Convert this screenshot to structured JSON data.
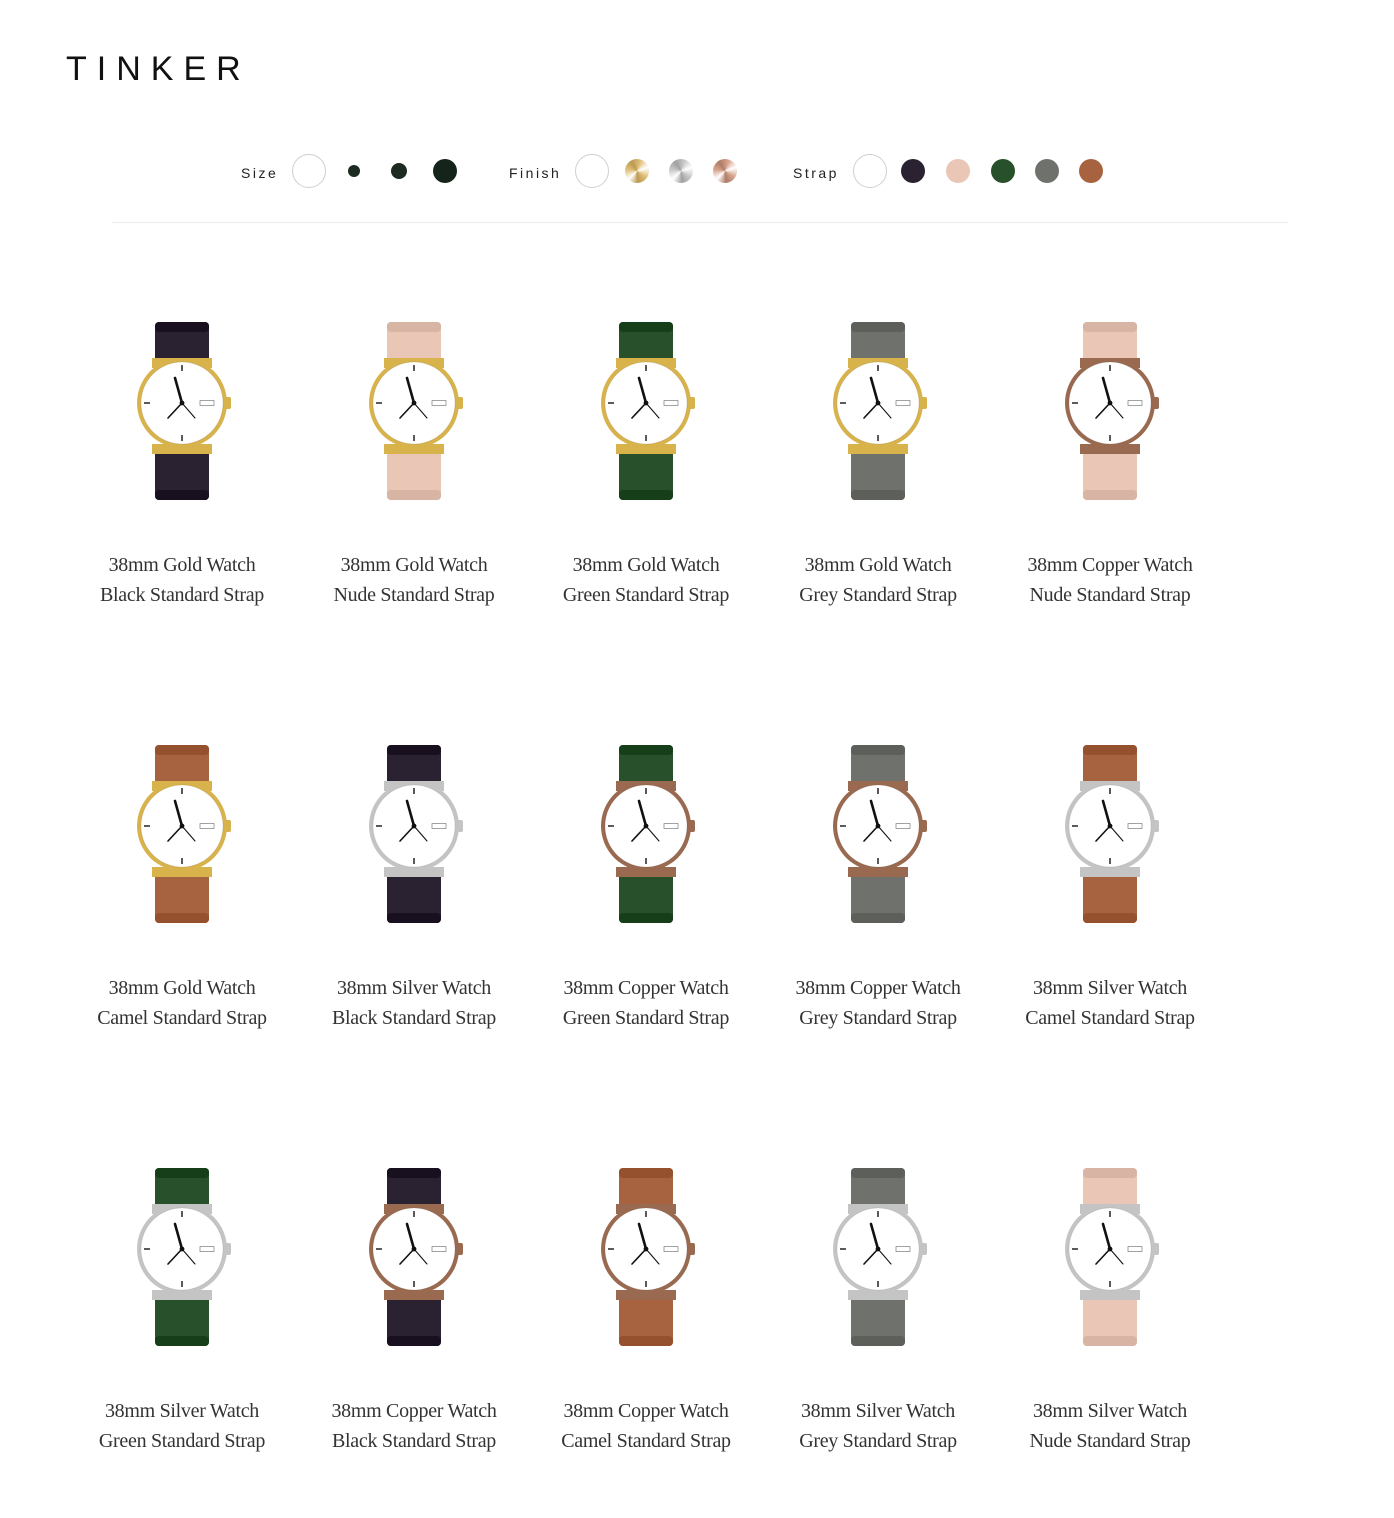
{
  "brand": {
    "logo_text": "TINKER"
  },
  "filters": {
    "size": {
      "label": "Size",
      "options": [
        {
          "name": "all",
          "color": "#ffffff"
        },
        {
          "name": "small",
          "color": "#1c2a20"
        },
        {
          "name": "medium",
          "color": "#1c2a20"
        },
        {
          "name": "large",
          "color": "#14241a"
        }
      ]
    },
    "finish": {
      "label": "Finish",
      "options": [
        {
          "name": "all",
          "color": "#ffffff"
        },
        {
          "name": "gold",
          "color": "#e2c17a"
        },
        {
          "name": "silver",
          "color": "#c9c9c9"
        },
        {
          "name": "copper",
          "color": "#d7a58f"
        }
      ]
    },
    "strap": {
      "label": "Strap",
      "options": [
        {
          "name": "all",
          "color": "#ffffff"
        },
        {
          "name": "black",
          "color": "#2a2230"
        },
        {
          "name": "nude",
          "color": "#e9c6b6"
        },
        {
          "name": "green",
          "color": "#28502a"
        },
        {
          "name": "grey",
          "color": "#6e716c"
        },
        {
          "name": "camel",
          "color": "#a7623f"
        }
      ]
    }
  },
  "products": [
    {
      "line1": "38mm Gold Watch",
      "line2": "Black Standard Strap",
      "finish": "gold",
      "strap": "black"
    },
    {
      "line1": "38mm Gold Watch",
      "line2": "Nude Standard Strap",
      "finish": "gold",
      "strap": "nude"
    },
    {
      "line1": "38mm Gold Watch",
      "line2": "Green Standard Strap",
      "finish": "gold",
      "strap": "green"
    },
    {
      "line1": "38mm Gold Watch",
      "line2": "Grey Standard Strap",
      "finish": "gold",
      "strap": "grey"
    },
    {
      "line1": "38mm Copper Watch",
      "line2": "Nude Standard Strap",
      "finish": "copper",
      "strap": "nude"
    },
    {
      "line1": "38mm Gold Watch",
      "line2": "Camel Standard Strap",
      "finish": "gold",
      "strap": "camel"
    },
    {
      "line1": "38mm Silver Watch",
      "line2": "Black Standard Strap",
      "finish": "silver",
      "strap": "black"
    },
    {
      "line1": "38mm Copper Watch",
      "line2": "Green Standard Strap",
      "finish": "copper",
      "strap": "green"
    },
    {
      "line1": "38mm Copper Watch",
      "line2": "Grey Standard Strap",
      "finish": "copper",
      "strap": "grey"
    },
    {
      "line1": "38mm Silver Watch",
      "line2": "Camel Standard Strap",
      "finish": "silver",
      "strap": "camel"
    },
    {
      "line1": "38mm Silver Watch",
      "line2": "Green Standard Strap",
      "finish": "silver",
      "strap": "green"
    },
    {
      "line1": "38mm Copper Watch",
      "line2": "Black Standard Strap",
      "finish": "copper",
      "strap": "black"
    },
    {
      "line1": "38mm Copper Watch",
      "line2": "Camel Standard Strap",
      "finish": "copper",
      "strap": "camel"
    },
    {
      "line1": "38mm Silver Watch",
      "line2": "Grey Standard Strap",
      "finish": "silver",
      "strap": "grey"
    },
    {
      "line1": "38mm Silver Watch",
      "line2": "Nude Standard Strap",
      "finish": "silver",
      "strap": "nude"
    }
  ]
}
